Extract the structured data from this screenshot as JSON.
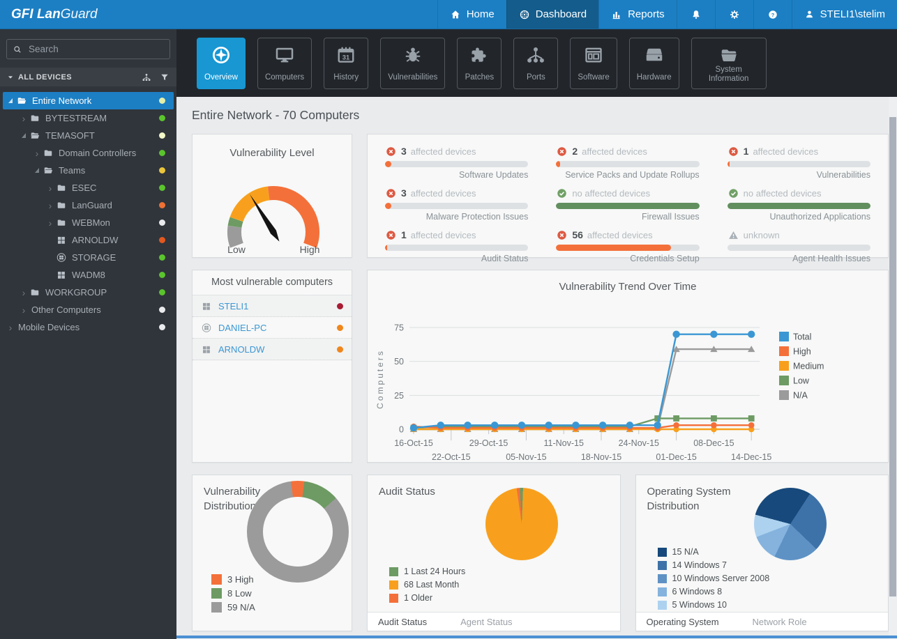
{
  "app": {
    "brand_bold": "GFI Lan",
    "brand_light": "Guard"
  },
  "nav": {
    "items": [
      {
        "label": "Home",
        "icon": "home",
        "active": false
      },
      {
        "label": "Dashboard",
        "icon": "dashboard",
        "active": true
      },
      {
        "label": "Reports",
        "icon": "reports",
        "active": false
      }
    ],
    "icon_buttons": [
      {
        "name": "notifications",
        "icon": "bell"
      },
      {
        "name": "settings",
        "icon": "gear"
      },
      {
        "name": "help",
        "icon": "help"
      }
    ],
    "user": "STELI1\\stelim"
  },
  "sidebar": {
    "search_placeholder": "Search",
    "header": "ALL DEVICES",
    "tree": [
      {
        "label": "Entire Network",
        "level": 0,
        "expander": "open",
        "icon": "folder-open",
        "dot": "#E4EFA9",
        "selected": true
      },
      {
        "label": "BYTESTREAM",
        "level": 1,
        "expander": "closed",
        "icon": "folder",
        "dot": "#5BC42D",
        "selected": false
      },
      {
        "label": "TEMASOFT",
        "level": 1,
        "expander": "open",
        "icon": "folder-open",
        "dot": "#F2F6C8",
        "selected": false
      },
      {
        "label": "Domain Controllers",
        "level": 2,
        "expander": "closed",
        "icon": "folder",
        "dot": "#5BC42D",
        "selected": false
      },
      {
        "label": "Teams",
        "level": 2,
        "expander": "open",
        "icon": "folder-open",
        "dot": "#E9C53B",
        "selected": false
      },
      {
        "label": "ESEC",
        "level": 3,
        "expander": "closed",
        "icon": "folder",
        "dot": "#5BC42D",
        "selected": false
      },
      {
        "label": "LanGuard",
        "level": 3,
        "expander": "closed",
        "icon": "folder",
        "dot": "#ED7134",
        "selected": false
      },
      {
        "label": "WEBMon",
        "level": 3,
        "expander": "closed",
        "icon": "folder",
        "dot": "#E8EAEC",
        "selected": false
      },
      {
        "label": "ARNOLDW",
        "level": 3,
        "expander": "none",
        "icon": "windows",
        "dot": "#E2581F",
        "selected": false
      },
      {
        "label": "STORAGE",
        "level": 3,
        "expander": "none",
        "icon": "windows-circle",
        "dot": "#5BC42D",
        "selected": false
      },
      {
        "label": "WADM8",
        "level": 3,
        "expander": "none",
        "icon": "windows",
        "dot": "#5BC42D",
        "selected": false
      },
      {
        "label": "WORKGROUP",
        "level": 1,
        "expander": "closed",
        "icon": "folder",
        "dot": "#5BC42D",
        "selected": false
      },
      {
        "label": "Other Computers",
        "level": 1,
        "expander": "closed",
        "icon": "none",
        "dot": "#E8EAEC",
        "selected": false
      },
      {
        "label": "Mobile Devices",
        "level": 0,
        "expander": "closed",
        "icon": "none",
        "dot": "#E8EAEC",
        "selected": false
      }
    ]
  },
  "toolbar": {
    "tabs": [
      {
        "label": "Overview",
        "icon": "overview",
        "active": true
      },
      {
        "label": "Computers",
        "icon": "computers",
        "active": false
      },
      {
        "label": "History",
        "icon": "history",
        "active": false
      },
      {
        "label": "Vulnerabilities",
        "icon": "vulnerabilities",
        "active": false
      },
      {
        "label": "Patches",
        "icon": "patches",
        "active": false
      },
      {
        "label": "Ports",
        "icon": "ports",
        "active": false
      },
      {
        "label": "Software",
        "icon": "software",
        "active": false
      },
      {
        "label": "Hardware",
        "icon": "hardware",
        "active": false
      },
      {
        "label": "System Information",
        "icon": "system-information",
        "active": false
      }
    ]
  },
  "page": {
    "title": "Entire Network - 70 Computers"
  },
  "status_tiles": [
    {
      "icon": "error",
      "count": "3",
      "text": "affected devices",
      "label": "Software Updates",
      "bar_pct": 4.3,
      "bar_color": "#F4703A"
    },
    {
      "icon": "error",
      "count": "2",
      "text": "affected devices",
      "label": "Service Packs and Update Rollups",
      "bar_pct": 2.9,
      "bar_color": "#F4703A"
    },
    {
      "icon": "error",
      "count": "1",
      "text": "affected devices",
      "label": "Vulnerabilities",
      "bar_pct": 1.6,
      "bar_color": "#F4703A"
    },
    {
      "icon": "error",
      "count": "3",
      "text": "affected devices",
      "label": "Malware Protection Issues",
      "bar_pct": 4.3,
      "bar_color": "#F4703A"
    },
    {
      "icon": "ok",
      "count": "",
      "text": "no affected devices",
      "label": "Firewall Issues",
      "bar_pct": 100,
      "bar_color": "#628F5E"
    },
    {
      "icon": "ok",
      "count": "",
      "text": "no affected devices",
      "label": "Unauthorized Applications",
      "bar_pct": 100,
      "bar_color": "#628F5E"
    },
    {
      "icon": "error",
      "count": "1",
      "text": "affected devices",
      "label": "Audit Status",
      "bar_pct": 1.6,
      "bar_color": "#F4703A"
    },
    {
      "icon": "error",
      "count": "56",
      "text": "affected devices",
      "label": "Credentials Setup",
      "bar_pct": 80,
      "bar_color": "#F4703A"
    },
    {
      "icon": "unknown",
      "count": "",
      "text": "unknown",
      "label": "Agent Health Issues",
      "bar_pct": 0,
      "bar_color": "#DEE1E4"
    }
  ],
  "most_vulnerable": {
    "title": "Most vulnerable computers",
    "computers": [
      {
        "name": "STELI1",
        "icon": "windows",
        "dot": "#A81C33"
      },
      {
        "name": "DANIEL-PC",
        "icon": "windows-circle",
        "dot": "#F0861C"
      },
      {
        "name": "ARNOLDW",
        "icon": "windows",
        "dot": "#F0861C"
      }
    ]
  },
  "panels": {
    "audit_tabs": [
      {
        "label": "Audit Status",
        "active": true
      },
      {
        "label": "Agent Status",
        "active": false
      }
    ],
    "os_tabs": [
      {
        "label": "Operating System",
        "active": true
      },
      {
        "label": "Network Role",
        "active": false
      }
    ]
  },
  "chart_data": [
    {
      "type": "gauge",
      "title": "Vulnerability Level",
      "min_label": "Low",
      "max_label": "High",
      "start_angle": 200,
      "needle_angle": 122,
      "segments": [
        {
          "color": "#9B9B9B",
          "span": 28
        },
        {
          "color": "#6D9B63",
          "span": 11
        },
        {
          "color": "#F8A01D",
          "span": 64
        },
        {
          "color": "#F4703A",
          "span": 117
        }
      ]
    },
    {
      "type": "line",
      "title": "Vulnerability Trend Over Time",
      "ylabel": "Computers",
      "yticks": [
        0,
        25,
        50,
        75
      ],
      "ylim": [
        0,
        80
      ],
      "grid": true,
      "legend_position": "right",
      "x_tick_labels": [
        "16-Oct-15",
        "22-Oct-15",
        "29-Oct-15",
        "05-Nov-15",
        "11-Nov-15",
        "18-Nov-15",
        "24-Nov-15",
        "01-Dec-15",
        "08-Dec-15",
        "14-Dec-15"
      ],
      "x": [
        0,
        0.72,
        1.44,
        2.16,
        2.88,
        3.6,
        4.32,
        5.04,
        5.76,
        6.5,
        7,
        8,
        9
      ],
      "series": [
        {
          "name": "Total",
          "color": "#3B97D3",
          "marker": "circle-lg",
          "values": [
            1,
            3,
            3,
            3,
            3,
            3,
            3,
            3,
            3,
            3,
            70,
            70,
            70
          ]
        },
        {
          "name": "High",
          "color": "#F4703A",
          "marker": "circle",
          "values": [
            2,
            1,
            1,
            1,
            1,
            1,
            1,
            1,
            1,
            1,
            3,
            3,
            3
          ]
        },
        {
          "name": "Medium",
          "color": "#F8A01D",
          "marker": "circle",
          "values": [
            0,
            0,
            0,
            0,
            0,
            0,
            0,
            0,
            0,
            0,
            0,
            0,
            0
          ]
        },
        {
          "name": "Low",
          "color": "#6D9B63",
          "marker": "square",
          "values": [
            1,
            2,
            2,
            2,
            2,
            2,
            2,
            2,
            2,
            8,
            8,
            8,
            8
          ]
        },
        {
          "name": "N/A",
          "color": "#9B9B9B",
          "marker": "triangle",
          "values": [
            0,
            0,
            0,
            0,
            0,
            0,
            0,
            0,
            0,
            1,
            59,
            59,
            59
          ]
        }
      ]
    },
    {
      "type": "pie",
      "variant": "donut",
      "title": "Vulnerability Distribution",
      "start_angle": -8,
      "slices": [
        {
          "value": 3,
          "label": "High",
          "color": "#F4703A"
        },
        {
          "value": 8,
          "label": "Low",
          "color": "#6D9B63"
        },
        {
          "value": 59,
          "label": "N/A",
          "color": "#9B9B9B"
        }
      ]
    },
    {
      "type": "pie",
      "title": "Audit Status",
      "start_angle": -3,
      "slices": [
        {
          "value": 1,
          "label": "Last 24 Hours",
          "color": "#6D9B63"
        },
        {
          "value": 68,
          "label": "Last Month",
          "color": "#F8A01D"
        },
        {
          "value": 1,
          "label": "Older",
          "color": "#F4703A"
        }
      ]
    },
    {
      "type": "pie",
      "title": "Operating System Distribution",
      "start_angle": -75,
      "slices": [
        {
          "value": 15,
          "label": "N/A",
          "color": "#17497C"
        },
        {
          "value": 14,
          "label": "Windows 7",
          "color": "#3D72A8"
        },
        {
          "value": 10,
          "label": "Windows Server 2008",
          "color": "#5E92C5"
        },
        {
          "value": 6,
          "label": "Windows 8",
          "color": "#85B3DE"
        },
        {
          "value": 5,
          "label": "Windows 10",
          "color": "#ADD2F0"
        }
      ]
    }
  ]
}
